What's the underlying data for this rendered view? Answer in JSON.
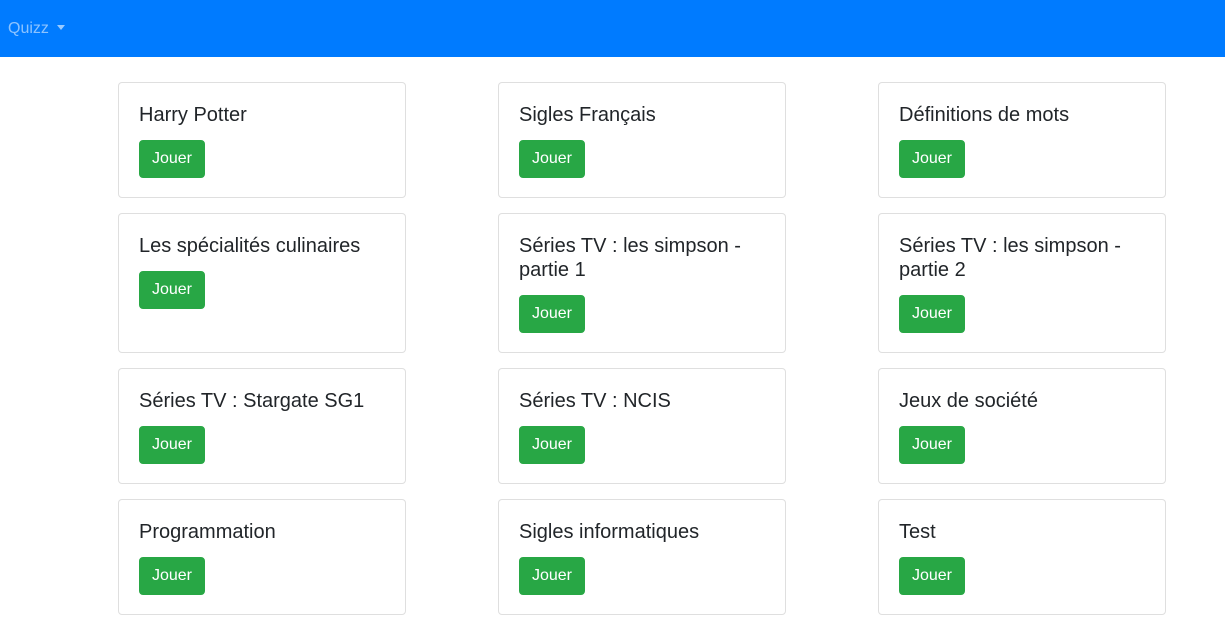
{
  "navbar": {
    "brand_dropdown_label": "Quizz",
    "background_color": "#007bff",
    "caret_icon": "caret-down-icon"
  },
  "quizzes": [
    {
      "title": "Harry Potter",
      "button_label": "Jouer"
    },
    {
      "title": "Sigles Français",
      "button_label": "Jouer"
    },
    {
      "title": "Définitions de mots",
      "button_label": "Jouer"
    },
    {
      "title": "Les spécialités culinaires",
      "button_label": "Jouer"
    },
    {
      "title": "Séries TV : les simpson - partie 1",
      "button_label": "Jouer"
    },
    {
      "title": "Séries TV : les simpson - partie 2",
      "button_label": "Jouer"
    },
    {
      "title": "Séries TV : Stargate SG1",
      "button_label": "Jouer"
    },
    {
      "title": "Séries TV : NCIS",
      "button_label": "Jouer"
    },
    {
      "title": "Jeux de société",
      "button_label": "Jouer"
    },
    {
      "title": "Programmation",
      "button_label": "Jouer"
    },
    {
      "title": "Sigles informatiques",
      "button_label": "Jouer"
    },
    {
      "title": "Test",
      "button_label": "Jouer"
    }
  ],
  "colors": {
    "play_button": "#28a745",
    "card_border": "rgba(0,0,0,0.125)"
  }
}
